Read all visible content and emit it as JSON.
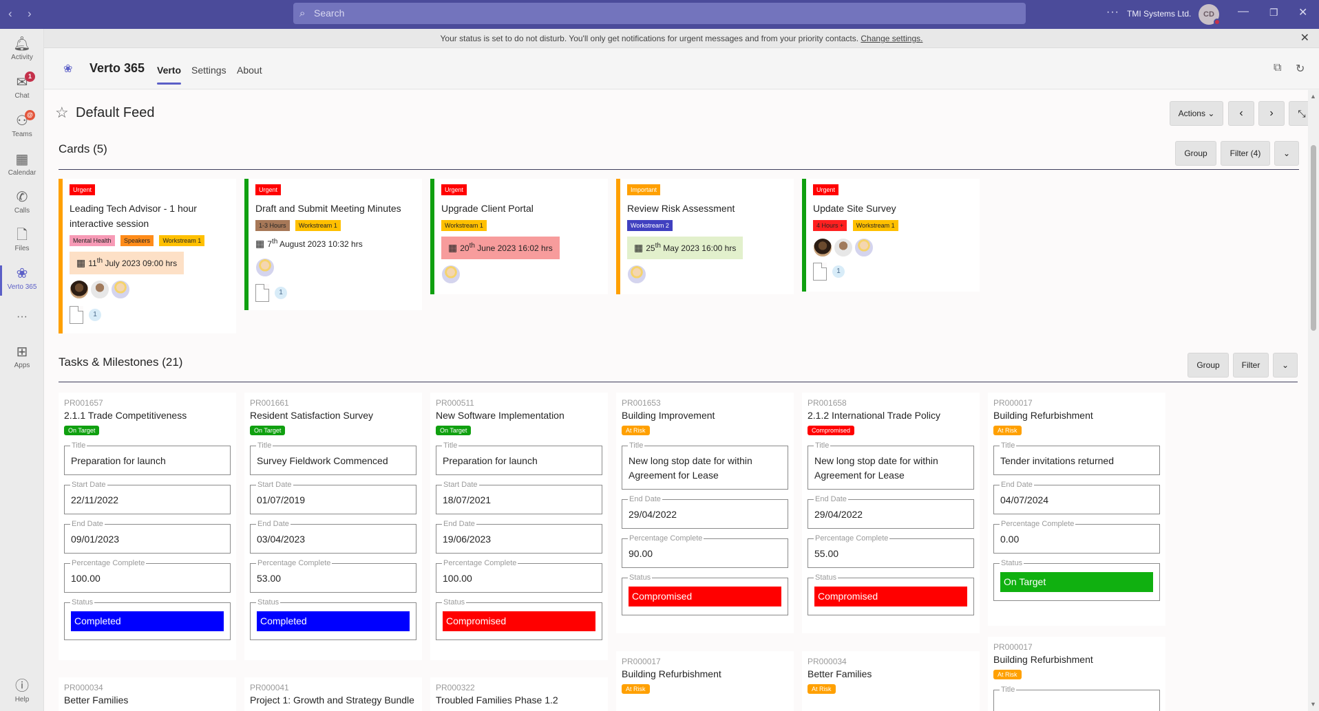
{
  "titlebar": {
    "search_placeholder": "Search",
    "org_name": "TMI Systems Ltd.",
    "avatar_initials": "CD"
  },
  "rail": {
    "items": [
      {
        "label": "Activity",
        "icon": "bell-icon"
      },
      {
        "label": "Chat",
        "icon": "chat-icon",
        "badge": "1"
      },
      {
        "label": "Teams",
        "icon": "teams-icon",
        "badge": "@"
      },
      {
        "label": "Calendar",
        "icon": "calendar-icon"
      },
      {
        "label": "Calls",
        "icon": "phone-icon"
      },
      {
        "label": "Files",
        "icon": "file-icon"
      },
      {
        "label": "Verto 365",
        "icon": "verto-icon"
      },
      {
        "label": "Apps",
        "icon": "apps-icon"
      }
    ],
    "more": "···",
    "help": "Help"
  },
  "notification": {
    "text": "Your status is set to do not disturb. You'll only get notifications for urgent messages and from your priority contacts.",
    "link": "Change settings."
  },
  "app": {
    "name": "Verto 365",
    "tabs": [
      "Verto",
      "Settings",
      "About"
    ],
    "active_tab": "Verto"
  },
  "feed": {
    "title": "Default Feed",
    "actions_label": "Actions"
  },
  "cards_section": {
    "title": "Cards (5)",
    "group_label": "Group",
    "filter_label": "Filter (4)",
    "cards": [
      {
        "priority": "Urgent",
        "title_lines": [
          "Leading Tech Advisor - 1 hour",
          "interactive session"
        ],
        "tags": [
          "Mental Health",
          "Speakers",
          "Workstream 1"
        ],
        "date_day": "11",
        "date_sup": "th",
        "date_rest": " July 2023 09:00 hrs",
        "date_bg": "#fde0c6",
        "avatars": 3,
        "doc_count": "1"
      },
      {
        "priority": "Urgent",
        "title_lines": [
          "Draft and Submit Meeting Minutes"
        ],
        "tags": [
          "1-3 Hours",
          "Workstream 1"
        ],
        "date_day": "7",
        "date_sup": "th",
        "date_rest": " August 2023 10:32 hrs",
        "date_bg": "#ffffff",
        "avatars": 1,
        "doc_count": "1"
      },
      {
        "priority": "Urgent",
        "title_lines": [
          "Upgrade Client Portal"
        ],
        "tags": [
          "Workstream 1"
        ],
        "date_day": "20",
        "date_sup": "th",
        "date_rest": " June 2023 16:02 hrs",
        "date_bg": "#f79c9c",
        "avatars": 1,
        "doc_count": ""
      },
      {
        "priority": "Important",
        "title_lines": [
          "Review Risk Assessment"
        ],
        "tags": [
          "Workstream 2"
        ],
        "date_day": "25",
        "date_sup": "th",
        "date_rest": " May 2023 16:00 hrs",
        "date_bg": "#e2f0cc",
        "avatars": 1,
        "doc_count": ""
      },
      {
        "priority": "Urgent",
        "title_lines": [
          "Update Site Survey"
        ],
        "tags": [
          "4 Hours +",
          "Workstream 1"
        ],
        "date_day": "",
        "date_sup": "",
        "date_rest": "",
        "date_bg": "",
        "avatars": 3,
        "doc_count": "1"
      }
    ]
  },
  "tasks_section": {
    "title": "Tasks & Milestones  (21)",
    "group_label": "Group",
    "filter_label": "Filter",
    "tiles": [
      {
        "code": "PR001657",
        "name": "2.1.1 Trade Competitiveness",
        "pill": "On Target",
        "f1_label": "Title",
        "f1_value": "Preparation for launch",
        "f2_label": "Start Date",
        "f2_value": "22/11/2022",
        "f3_label": "End Date",
        "f3_value": "09/01/2023",
        "f4_label": "Percentage Complete",
        "f4_value": "100.00",
        "status_label": "Status",
        "status_value": "Completed"
      },
      {
        "code": "PR001661",
        "name": "Resident Satisfaction Survey",
        "pill": "On Target",
        "f1_label": "Title",
        "f1_value": "Survey Fieldwork Commenced",
        "f2_label": "Start Date",
        "f2_value": "01/07/2019",
        "f3_label": "End Date",
        "f3_value": "03/04/2023",
        "f4_label": "Percentage Complete",
        "f4_value": "53.00",
        "status_label": "Status",
        "status_value": "Completed"
      },
      {
        "code": "PR000511",
        "name": "New Software Implementation",
        "pill": "On Target",
        "f1_label": "Title",
        "f1_value": "Preparation for launch",
        "f2_label": "Start Date",
        "f2_value": "18/07/2021",
        "f3_label": "End Date",
        "f3_value": "19/06/2023",
        "f4_label": "Percentage Complete",
        "f4_value": "100.00",
        "status_label": "Status",
        "status_value": "Compromised"
      },
      {
        "code": "PR001653",
        "name": "Building Improvement",
        "pill": "At Risk",
        "f1_label": "Title",
        "f1_value_1": "New long stop date for within",
        "f1_value_2": "Agreement for Lease",
        "f3_label": "End Date",
        "f3_value": "29/04/2022",
        "f4_label": "Percentage Complete",
        "f4_value": "90.00",
        "status_label": "Status",
        "status_value": "Compromised"
      },
      {
        "code": "PR001658",
        "name": "2.1.2 International Trade Policy",
        "pill": "Compromised",
        "f1_label": "Title",
        "f1_value_1": "New long stop date for within",
        "f1_value_2": "Agreement for Lease",
        "f3_label": "End Date",
        "f3_value": "29/04/2022",
        "f4_label": "Percentage Complete",
        "f4_value": "55.00",
        "status_label": "Status",
        "status_value": "Compromised"
      },
      {
        "code": "PR000017",
        "name": "Building Refurbishment",
        "pill": "At Risk",
        "f1_label": "Title",
        "f1_value": "Tender invitations returned",
        "f3_label": "End Date",
        "f3_value": "04/07/2024",
        "f4_label": "Percentage Complete",
        "f4_value": "0.00",
        "status_label": "Status",
        "status_value": "On Target"
      }
    ],
    "second_row": [
      {
        "code": "PR000034",
        "name": "Better Families"
      },
      {
        "code": "PR000041",
        "name": "Project 1: Growth and Strategy Bundle"
      },
      {
        "code": "PR000322",
        "name": "Troubled Families Phase 1.2"
      },
      {
        "code": "PR000017",
        "name": "Building Refurbishment",
        "pill": "At Risk"
      },
      {
        "code": "PR000034",
        "name": "Better Families",
        "pill": "At Risk"
      },
      {
        "code": "PR000017",
        "name": "Building Refurbishment",
        "pill": "At Risk",
        "f1_label": "Title"
      }
    ]
  }
}
